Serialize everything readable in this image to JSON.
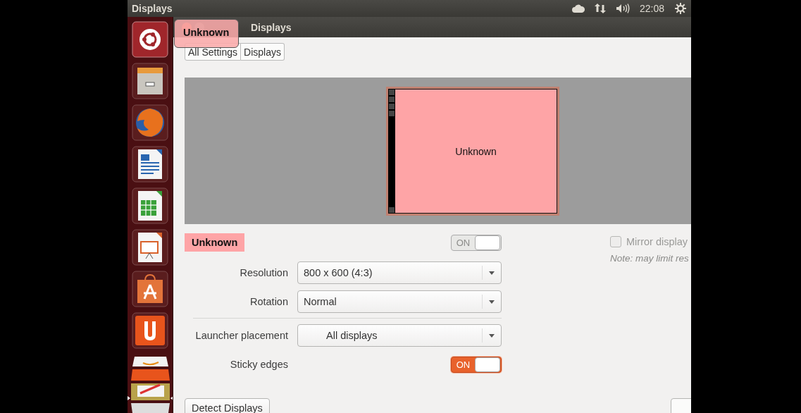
{
  "top_panel": {
    "app_title": "Displays",
    "clock": "22:08"
  },
  "window": {
    "title": "Displays"
  },
  "tooltip": {
    "text": "Unknown"
  },
  "breadcrumb": [
    "All Settings",
    "Displays"
  ],
  "preview": {
    "monitor_label": "Unknown"
  },
  "display": {
    "name": "Unknown",
    "power": {
      "label": "ON",
      "on": true,
      "disabled": true
    }
  },
  "mirror": {
    "label": "Mirror display",
    "checked": false,
    "disabled": true,
    "note": "Note: may limit res"
  },
  "settings_groups": [
    [
      {
        "kind": "dropdown",
        "label": "Resolution",
        "value": "800 x 600 (4:3)"
      },
      {
        "kind": "dropdown",
        "label": "Rotation",
        "value": "Normal"
      }
    ],
    [
      {
        "kind": "dropdown",
        "label": "Launcher placement",
        "value": "All displays",
        "centered": true
      },
      {
        "kind": "toggle",
        "label": "Sticky edges",
        "value": "ON",
        "on": true,
        "disabled": false
      }
    ]
  ],
  "buttons": [
    "Detect Displays"
  ]
}
